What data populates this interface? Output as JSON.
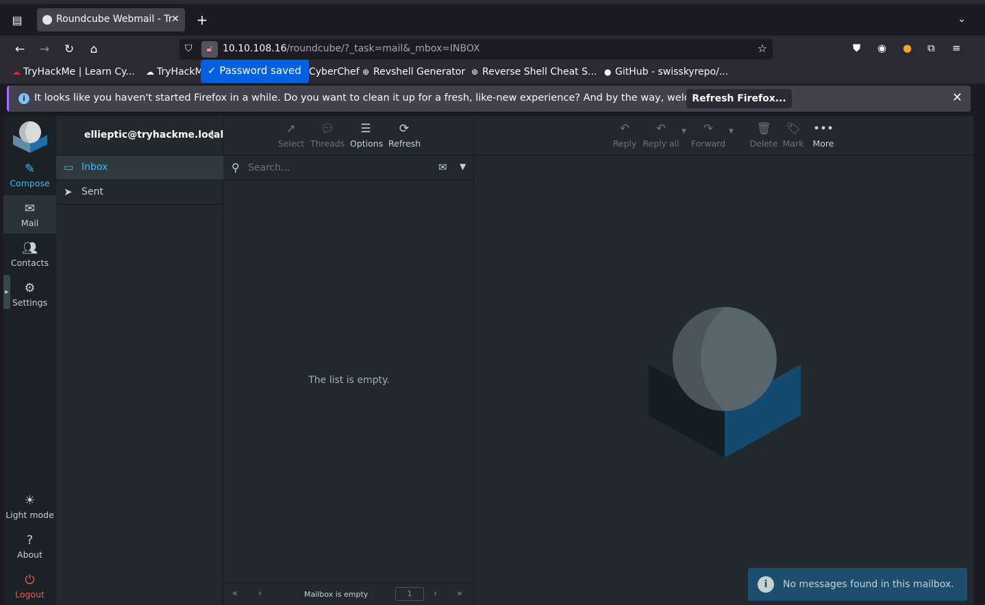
{
  "browser": {
    "tab_title": "Roundcube Webmail - Try",
    "url_host": "10.10.108.16",
    "url_path": "/roundcube/?_task=mail&_mbox=INBOX",
    "password_saved": "Password saved",
    "bookmarks": [
      {
        "label": "TryHackMe | Learn Cy..."
      },
      {
        "label": "TryHackM"
      },
      {
        "label": "CyberChef"
      },
      {
        "label": "Revshell Generator"
      },
      {
        "label": "Reverse Shell Cheat S..."
      },
      {
        "label": "GitHub - swisskyrepo/..."
      }
    ],
    "notification": {
      "message": "It looks like you haven't started Firefox in a while. Do you want to clean it up for a fresh, like-new experience? And by the way, welcome back!",
      "button": "Refresh Firefox..."
    }
  },
  "taskmenu": {
    "compose": "Compose",
    "mail": "Mail",
    "contacts": "Contacts",
    "settings": "Settings",
    "light_mode": "Light mode",
    "about": "About",
    "logout": "Logout"
  },
  "folders": {
    "account": "ellieptic@tryhackme.local",
    "items": [
      {
        "label": "Inbox",
        "icon": "inbox-icon"
      },
      {
        "label": "Sent",
        "icon": "paper-plane-icon"
      }
    ]
  },
  "list": {
    "toolbar": {
      "select": "Select",
      "threads": "Threads",
      "options": "Options",
      "refresh": "Refresh"
    },
    "search_placeholder": "Search...",
    "empty": "The list is empty.",
    "footer_status": "Mailbox is empty",
    "page": "1"
  },
  "content_toolbar": {
    "reply": "Reply",
    "reply_all": "Reply all",
    "forward": "Forward",
    "delete": "Delete",
    "mark": "Mark",
    "more": "More"
  },
  "toast": "No messages found in this mailbox.",
  "colors": {
    "accent": "#37beff",
    "logout": "#ff5552",
    "toast": "#1d4e6d"
  }
}
